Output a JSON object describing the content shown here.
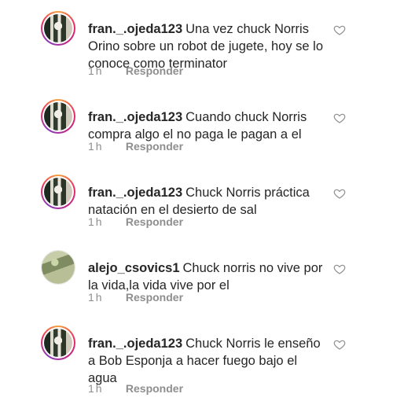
{
  "comments": [
    {
      "username": "fran._.ojeda123",
      "text": "Una vez chuck Norris Orino sobre un robot de jugete, hoy se lo conoce como terminator",
      "time": "1h",
      "reply_label": "Responder",
      "avatar_icon": "user-avatar-story-ring",
      "like_icon": "heart-outline-icon"
    },
    {
      "username": "fran._.ojeda123",
      "text": "Cuando chuck Norris compra algo el no paga le pagan a el",
      "time": "1h",
      "reply_label": "Responder",
      "avatar_icon": "user-avatar-story-ring",
      "like_icon": "heart-outline-icon"
    },
    {
      "username": "fran._.ojeda123",
      "text": "Chuck Norris práctica natación en el desierto de sal",
      "time": "1h",
      "reply_label": "Responder",
      "avatar_icon": "user-avatar-story-ring",
      "like_icon": "heart-outline-icon"
    },
    {
      "username": "alejo_csovics1",
      "text": "Chuck norris no vive por la vida,la vida vive por el",
      "time": "1h",
      "reply_label": "Responder",
      "avatar_icon": "user-avatar",
      "like_icon": "heart-outline-icon"
    },
    {
      "username": "fran._.ojeda123",
      "text": "Chuck Norris le enseño a Bob Esponja a hacer fuego bajo el agua",
      "time": "1h",
      "reply_label": "Responder",
      "avatar_icon": "user-avatar-story-ring",
      "like_icon": "heart-outline-icon"
    }
  ],
  "colors": {
    "text": "#262626",
    "muted": "#8e8e8e",
    "ring_gradient": [
      "#f9a13a",
      "#e8315f",
      "#c5238a",
      "#8a3ab9"
    ]
  }
}
